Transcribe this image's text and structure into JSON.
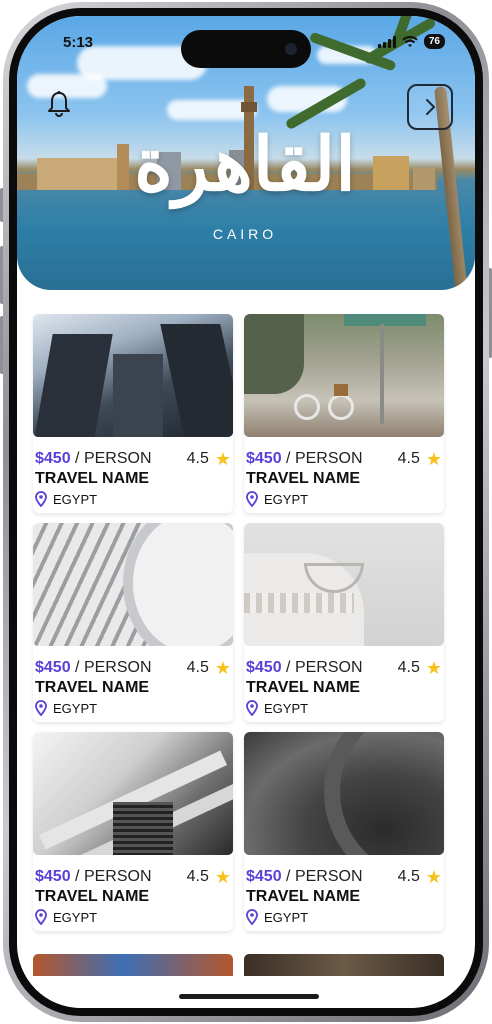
{
  "status": {
    "time": "5:13",
    "battery": "76"
  },
  "hero": {
    "title_ar": "القاهرة",
    "title_en": "CAIRO",
    "icons": {
      "notification": "bell-icon",
      "next": "chevron-right-icon"
    }
  },
  "colors": {
    "accent": "#5a3fd8",
    "star": "#f7c21a",
    "location_icon": "#5a3fd8"
  },
  "cards": [
    {
      "price": "$450",
      "unit": "/ PERSON",
      "rating": "4.5",
      "name": "TRAVEL NAME",
      "location": "EGYPT",
      "image": "glass-skyscrapers"
    },
    {
      "price": "$450",
      "unit": "/ PERSON",
      "rating": "4.5",
      "name": "TRAVEL NAME",
      "location": "EGYPT",
      "image": "street-bicycle"
    },
    {
      "price": "$450",
      "unit": "/ PERSON",
      "rating": "4.5",
      "name": "TRAVEL NAME",
      "location": "EGYPT",
      "image": "white-curved-architecture"
    },
    {
      "price": "$450",
      "unit": "/ PERSON",
      "rating": "4.5",
      "name": "TRAVEL NAME",
      "location": "EGYPT",
      "image": "white-balcony-building"
    },
    {
      "price": "$450",
      "unit": "/ PERSON",
      "rating": "4.5",
      "name": "TRAVEL NAME",
      "location": "EGYPT",
      "image": "white-staircase-interior"
    },
    {
      "price": "$450",
      "unit": "/ PERSON",
      "rating": "4.5",
      "name": "TRAVEL NAME",
      "location": "EGYPT",
      "image": "dark-curved-architecture"
    }
  ]
}
